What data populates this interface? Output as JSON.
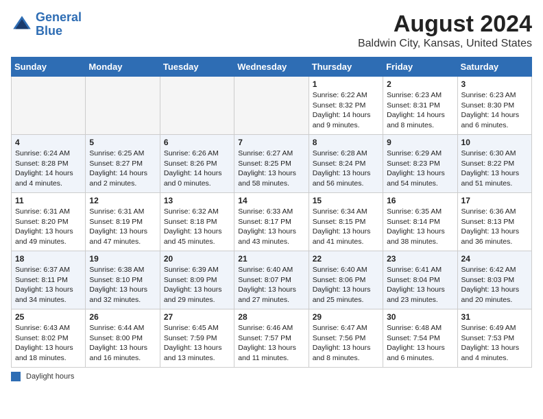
{
  "header": {
    "logo_line1": "General",
    "logo_line2": "Blue",
    "title": "August 2024",
    "subtitle": "Baldwin City, Kansas, United States"
  },
  "days_of_week": [
    "Sunday",
    "Monday",
    "Tuesday",
    "Wednesday",
    "Thursday",
    "Friday",
    "Saturday"
  ],
  "weeks": [
    [
      {
        "day": "",
        "info": ""
      },
      {
        "day": "",
        "info": ""
      },
      {
        "day": "",
        "info": ""
      },
      {
        "day": "",
        "info": ""
      },
      {
        "day": "1",
        "info": "Sunrise: 6:22 AM\nSunset: 8:32 PM\nDaylight: 14 hours\nand 9 minutes."
      },
      {
        "day": "2",
        "info": "Sunrise: 6:23 AM\nSunset: 8:31 PM\nDaylight: 14 hours\nand 8 minutes."
      },
      {
        "day": "3",
        "info": "Sunrise: 6:23 AM\nSunset: 8:30 PM\nDaylight: 14 hours\nand 6 minutes."
      }
    ],
    [
      {
        "day": "4",
        "info": "Sunrise: 6:24 AM\nSunset: 8:28 PM\nDaylight: 14 hours\nand 4 minutes."
      },
      {
        "day": "5",
        "info": "Sunrise: 6:25 AM\nSunset: 8:27 PM\nDaylight: 14 hours\nand 2 minutes."
      },
      {
        "day": "6",
        "info": "Sunrise: 6:26 AM\nSunset: 8:26 PM\nDaylight: 14 hours\nand 0 minutes."
      },
      {
        "day": "7",
        "info": "Sunrise: 6:27 AM\nSunset: 8:25 PM\nDaylight: 13 hours\nand 58 minutes."
      },
      {
        "day": "8",
        "info": "Sunrise: 6:28 AM\nSunset: 8:24 PM\nDaylight: 13 hours\nand 56 minutes."
      },
      {
        "day": "9",
        "info": "Sunrise: 6:29 AM\nSunset: 8:23 PM\nDaylight: 13 hours\nand 54 minutes."
      },
      {
        "day": "10",
        "info": "Sunrise: 6:30 AM\nSunset: 8:22 PM\nDaylight: 13 hours\nand 51 minutes."
      }
    ],
    [
      {
        "day": "11",
        "info": "Sunrise: 6:31 AM\nSunset: 8:20 PM\nDaylight: 13 hours\nand 49 minutes."
      },
      {
        "day": "12",
        "info": "Sunrise: 6:31 AM\nSunset: 8:19 PM\nDaylight: 13 hours\nand 47 minutes."
      },
      {
        "day": "13",
        "info": "Sunrise: 6:32 AM\nSunset: 8:18 PM\nDaylight: 13 hours\nand 45 minutes."
      },
      {
        "day": "14",
        "info": "Sunrise: 6:33 AM\nSunset: 8:17 PM\nDaylight: 13 hours\nand 43 minutes."
      },
      {
        "day": "15",
        "info": "Sunrise: 6:34 AM\nSunset: 8:15 PM\nDaylight: 13 hours\nand 41 minutes."
      },
      {
        "day": "16",
        "info": "Sunrise: 6:35 AM\nSunset: 8:14 PM\nDaylight: 13 hours\nand 38 minutes."
      },
      {
        "day": "17",
        "info": "Sunrise: 6:36 AM\nSunset: 8:13 PM\nDaylight: 13 hours\nand 36 minutes."
      }
    ],
    [
      {
        "day": "18",
        "info": "Sunrise: 6:37 AM\nSunset: 8:11 PM\nDaylight: 13 hours\nand 34 minutes."
      },
      {
        "day": "19",
        "info": "Sunrise: 6:38 AM\nSunset: 8:10 PM\nDaylight: 13 hours\nand 32 minutes."
      },
      {
        "day": "20",
        "info": "Sunrise: 6:39 AM\nSunset: 8:09 PM\nDaylight: 13 hours\nand 29 minutes."
      },
      {
        "day": "21",
        "info": "Sunrise: 6:40 AM\nSunset: 8:07 PM\nDaylight: 13 hours\nand 27 minutes."
      },
      {
        "day": "22",
        "info": "Sunrise: 6:40 AM\nSunset: 8:06 PM\nDaylight: 13 hours\nand 25 minutes."
      },
      {
        "day": "23",
        "info": "Sunrise: 6:41 AM\nSunset: 8:04 PM\nDaylight: 13 hours\nand 23 minutes."
      },
      {
        "day": "24",
        "info": "Sunrise: 6:42 AM\nSunset: 8:03 PM\nDaylight: 13 hours\nand 20 minutes."
      }
    ],
    [
      {
        "day": "25",
        "info": "Sunrise: 6:43 AM\nSunset: 8:02 PM\nDaylight: 13 hours\nand 18 minutes."
      },
      {
        "day": "26",
        "info": "Sunrise: 6:44 AM\nSunset: 8:00 PM\nDaylight: 13 hours\nand 16 minutes."
      },
      {
        "day": "27",
        "info": "Sunrise: 6:45 AM\nSunset: 7:59 PM\nDaylight: 13 hours\nand 13 minutes."
      },
      {
        "day": "28",
        "info": "Sunrise: 6:46 AM\nSunset: 7:57 PM\nDaylight: 13 hours\nand 11 minutes."
      },
      {
        "day": "29",
        "info": "Sunrise: 6:47 AM\nSunset: 7:56 PM\nDaylight: 13 hours\nand 8 minutes."
      },
      {
        "day": "30",
        "info": "Sunrise: 6:48 AM\nSunset: 7:54 PM\nDaylight: 13 hours\nand 6 minutes."
      },
      {
        "day": "31",
        "info": "Sunrise: 6:49 AM\nSunset: 7:53 PM\nDaylight: 13 hours\nand 4 minutes."
      }
    ]
  ],
  "footer": {
    "legend_label": "Daylight hours"
  }
}
